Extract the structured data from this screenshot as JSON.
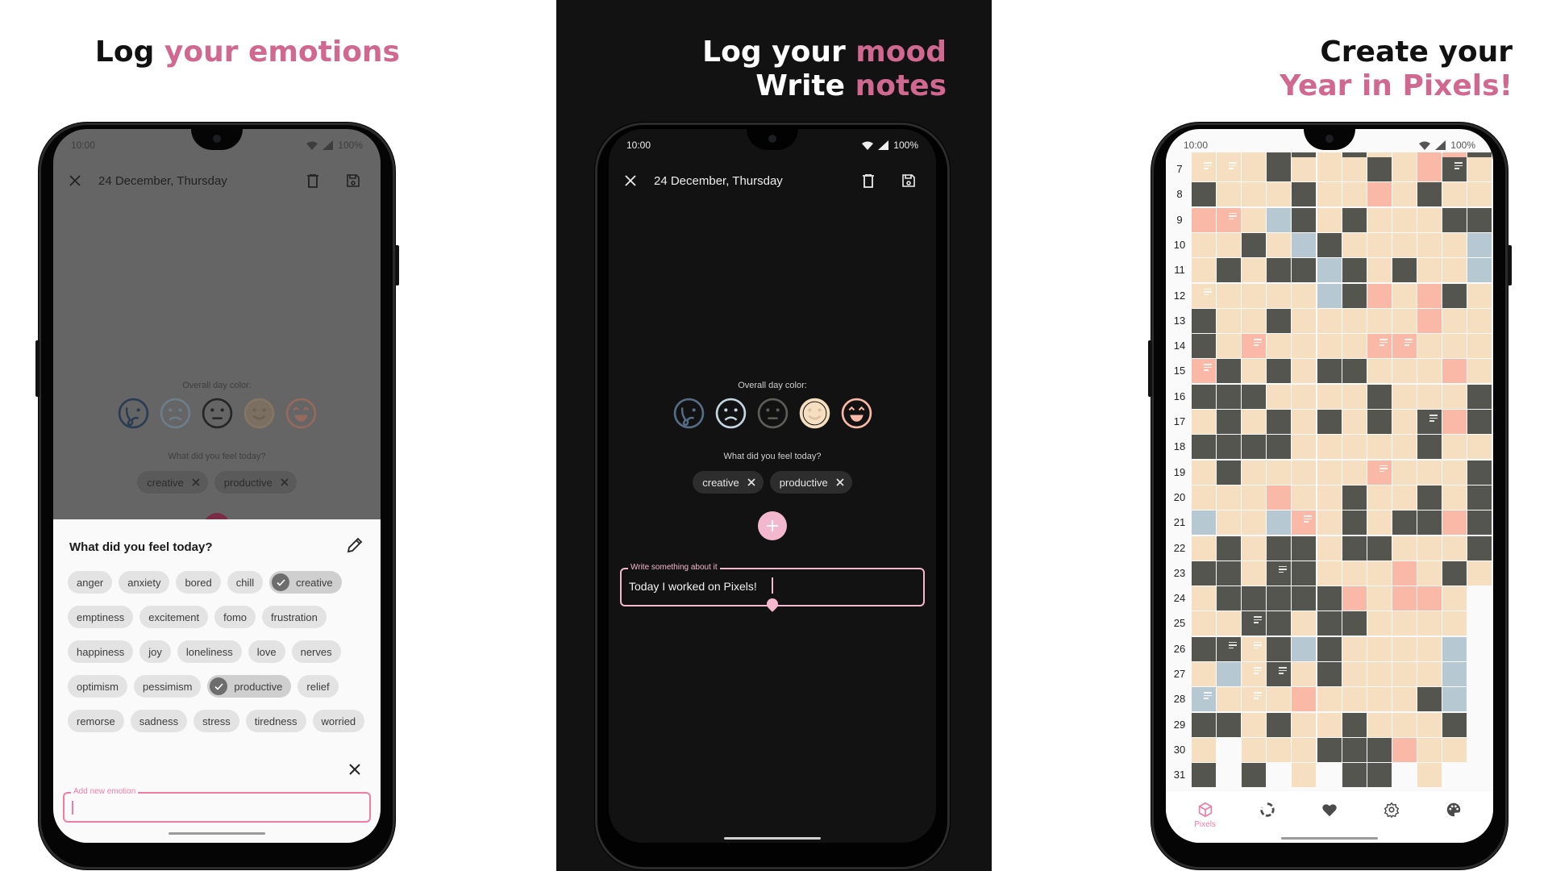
{
  "colors": {
    "accent_title": "#d06890",
    "pink": "#f07ca4",
    "fab": "#f4b8ce",
    "mood_peach": "#f6dfc0",
    "mood_dark": "#55554f",
    "mood_pink": "#f9b9a6",
    "mood_blue": "#b6c9d2"
  },
  "panels": [
    {
      "headline": {
        "lines": [
          {
            "plain": "Log ",
            "accent": "your emotions"
          }
        ]
      },
      "status": {
        "time": "10:00",
        "battery": "100%"
      },
      "appbar": {
        "title": "24  December, Thursday"
      },
      "overall_label": "Overall day color:",
      "feel_label": "What did you feel today?",
      "selected_chips": [
        "creative",
        "productive"
      ],
      "sheet": {
        "title": "What did you feel today?",
        "emotion_rows": [
          [
            {
              "label": "anger"
            },
            {
              "label": "anxiety"
            },
            {
              "label": "bored"
            },
            {
              "label": "chill"
            },
            {
              "label": "creative",
              "selected": true
            }
          ],
          [
            {
              "label": "emptiness"
            },
            {
              "label": "excitement"
            },
            {
              "label": "fomo"
            },
            {
              "label": "frustration"
            }
          ],
          [
            {
              "label": "happiness"
            },
            {
              "label": "joy"
            },
            {
              "label": "loneliness"
            },
            {
              "label": "love"
            },
            {
              "label": "nerves"
            }
          ],
          [
            {
              "label": "optimism"
            },
            {
              "label": "pessimism"
            },
            {
              "label": "productive",
              "selected": true
            },
            {
              "label": "relief"
            }
          ],
          [
            {
              "label": "remorse"
            },
            {
              "label": "sadness"
            },
            {
              "label": "stress"
            },
            {
              "label": "tiredness"
            },
            {
              "label": "worried"
            }
          ]
        ],
        "new_emotion_label": "Add new emotion",
        "new_emotion_value": ""
      }
    },
    {
      "headline": {
        "lines": [
          {
            "plain": "Log your ",
            "accent": "mood"
          },
          {
            "plain": "Write ",
            "accent": "notes"
          }
        ]
      },
      "status": {
        "time": "10:00",
        "battery": "100%"
      },
      "appbar": {
        "title": "24  December, Thursday"
      },
      "overall_label": "Overall day color:",
      "feel_label": "What did you feel today?",
      "selected_chips": [
        "creative",
        "productive"
      ],
      "note_field": {
        "label": "Write something about it",
        "value": "Today I worked on Pixels!"
      }
    },
    {
      "headline": {
        "lines": [
          {
            "plain": "Create your",
            "accent": ""
          },
          {
            "plain": "",
            "accent": "Year in Pixels!"
          }
        ]
      },
      "status": {
        "time": "10:00",
        "battery": "100%"
      },
      "pixels": {
        "legend": {
          "p": "peach",
          "d": "dark",
          "r": "pink",
          "b": "blue",
          "w": "empty"
        },
        "partial_row": "pppddpdpprrd",
        "rows": [
          {
            "day": "7",
            "cells": "pppdpppdprdp",
            "notes": [
              0,
              1,
              10
            ]
          },
          {
            "day": "8",
            "cells": "dpppdpprpdpp",
            "notes": []
          },
          {
            "day": "9",
            "cells": "rrpbdpdpppdd",
            "notes": [
              1
            ]
          },
          {
            "day": "10",
            "cells": "ppdpbdpppppb",
            "notes": []
          },
          {
            "day": "11",
            "cells": "pdpddbdpdppb",
            "notes": []
          },
          {
            "day": "12",
            "cells": "pppppbdrprdp",
            "notes": [
              0
            ]
          },
          {
            "day": "13",
            "cells": "dppdpppppr pp",
            "notes": []
          },
          {
            "day": "14",
            "cells": "dprpppprrppp",
            "notes": [
              2,
              7,
              8
            ]
          },
          {
            "day": "15",
            "cells": "rdpdpddppprp",
            "notes": [
              0
            ]
          },
          {
            "day": "16",
            "cells": "dddppppdpppd",
            "notes": []
          },
          {
            "day": "17",
            "cells": "pdpdpdpdpdrd",
            "notes": [
              9
            ]
          },
          {
            "day": "18",
            "cells": "ddddpppppdpp",
            "notes": []
          },
          {
            "day": "19",
            "cells": "pdpppppr pppd",
            "notes": [
              7
            ]
          },
          {
            "day": "20",
            "cells": "ppprppdppdpd",
            "notes": []
          },
          {
            "day": "21",
            "cells": "bppbrpdpddrd",
            "notes": [
              4
            ]
          },
          {
            "day": "22",
            "cells": "pdpddpddpppd",
            "notes": []
          },
          {
            "day": "23",
            "cells": "ddpddppprpdp",
            "notes": [
              3
            ]
          },
          {
            "day": "24",
            "cells": "pdddddrprrpw",
            "notes": []
          },
          {
            "day": "25",
            "cells": "ppddpddppppw",
            "notes": [
              2
            ]
          },
          {
            "day": "26",
            "cells": "ddpdbdppppbw",
            "notes": [
              1,
              2
            ]
          },
          {
            "day": "27",
            "cells": "pbpdpdppppbw",
            "notes": [
              2,
              3
            ]
          },
          {
            "day": "28",
            "cells": "bpppr ppppdbw",
            "notes": [
              0,
              2
            ]
          },
          {
            "day": "29",
            "cells": "ddpdppdpppdw",
            "notes": []
          },
          {
            "day": "30",
            "cells": "pwpppdddrppw",
            "notes": []
          },
          {
            "day": "31",
            "cells": "dwdwpwddwpww",
            "notes": []
          }
        ]
      },
      "bottom_nav": [
        {
          "label": "Pixels",
          "icon": "cube-icon",
          "active": true
        },
        {
          "label": "",
          "icon": "statistics-icon",
          "active": false
        },
        {
          "label": "",
          "icon": "heart-icon",
          "active": false
        },
        {
          "label": "",
          "icon": "settings-icon",
          "active": false
        },
        {
          "label": "",
          "icon": "palette-icon",
          "active": false
        }
      ]
    }
  ]
}
